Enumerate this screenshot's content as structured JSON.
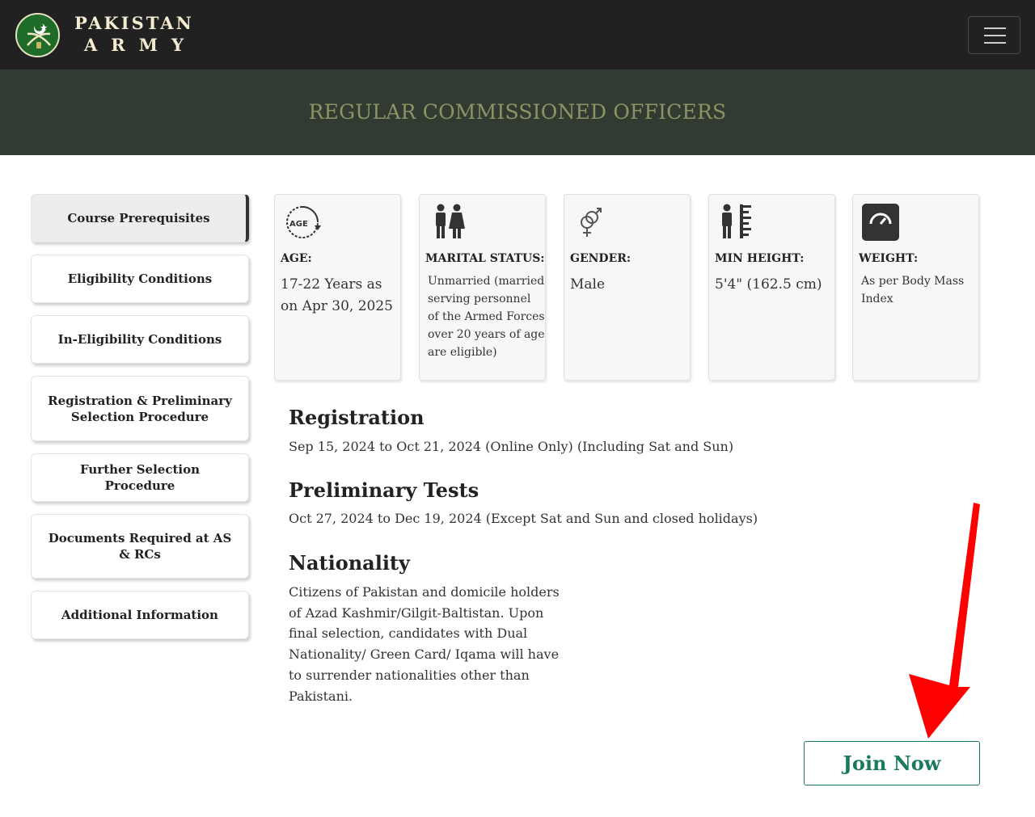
{
  "brand": {
    "line1": "PAKISTAN",
    "line2": "ARMY"
  },
  "banner": {
    "title": "REGULAR COMMISSIONED OFFICERS"
  },
  "sidebar": {
    "items": [
      {
        "label": "Course Prerequisites",
        "active": true
      },
      {
        "label": "Eligibility Conditions"
      },
      {
        "label": "In-Eligibility Conditions"
      },
      {
        "label": "Registration & Preliminary Selection Procedure"
      },
      {
        "label": "Further Selection Procedure"
      },
      {
        "label": "Documents Required at AS & RCs"
      },
      {
        "label": "Additional Information"
      }
    ]
  },
  "cards": [
    {
      "icon": "age-icon",
      "icon_text": "AGE",
      "title": "AGE:",
      "value": "17-22 Years as on Apr 30, 2025"
    },
    {
      "icon": "couple-icon",
      "title": "MARITAL STATUS:",
      "value": "Unmarried (married serving personnel of the Armed Forces over 20 years of age are eligible)"
    },
    {
      "icon": "gender-icon",
      "title": "GENDER:",
      "value": "Male"
    },
    {
      "icon": "height-icon",
      "title": "MIN HEIGHT:",
      "value": "5'4\" (162.5 cm)"
    },
    {
      "icon": "weight-scale-icon",
      "title": "WEIGHT:",
      "value": "As per Body Mass Index"
    }
  ],
  "sections": {
    "registration": {
      "heading": "Registration",
      "text": "Sep 15, 2024 to Oct 21, 2024 (Online Only) (Including Sat and Sun)"
    },
    "preliminary": {
      "heading": "Preliminary Tests",
      "text": "Oct 27, 2024 to Dec 19, 2024 (Except Sat and Sun and closed holidays)"
    },
    "nationality": {
      "heading": "Nationality",
      "text": "Citizens of Pakistan and domicile holders of Azad Kashmir/Gilgit-Baltistan. Upon final selection, candidates with Dual Nationality/ Green Card/ Iqama will have to surrender nationalities other than Pakistani."
    }
  },
  "join": {
    "label": "Join Now"
  },
  "colors": {
    "navbar": "#212121",
    "banner": "#313b31",
    "banner_text": "#8c9466",
    "accent": "#1a7a5e",
    "arrow": "#ff0000"
  }
}
